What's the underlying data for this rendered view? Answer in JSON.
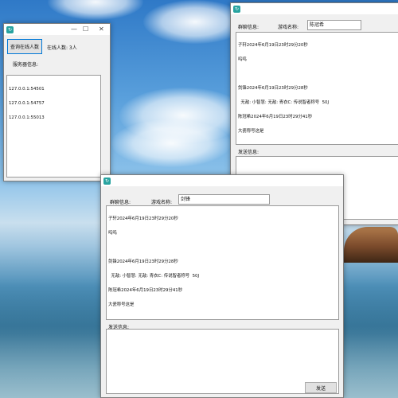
{
  "server_window": {
    "icon": "app-icon",
    "controls": [
      "—",
      "☐",
      "✕"
    ],
    "query_button": "查询在线人数",
    "online_count": "在线人数: 3人",
    "server_info_label": "服务器信息:",
    "server_lines": [
      "127.0.0.1:54501",
      "127.0.0.1:54757",
      "127.0.0.1:55013"
    ]
  },
  "client_back": {
    "icon": "app-icon",
    "group_info_label": "群聊信息:",
    "game_name_label": "游戏名称:",
    "game_name_value": "陈冠希",
    "chat_lines": [
      "子轩2024年6月19日23时29分20秒",
      "呜呜",
      "",
      "剑锋2024年6月19日23时29分28秒",
      "  无敌: 小智慧: 无敌: 青衣C: 传说智者称号  50J",
      "陈冠希2024年6月19日23时29分41秒",
      "大瓷称号这是"
    ],
    "send_label": "发送信息:"
  },
  "client_front": {
    "icon": "app-icon",
    "group_info_label": "群聊信息:",
    "game_name_label": "游戏名称:",
    "game_name_value": "剑锋",
    "chat_lines": [
      "子轩2024年6月19日23时29分20秒",
      "呜呜",
      "",
      "剑锋2024年6月19日23时29分28秒",
      "  无敌: 小智慧: 无敌: 青衣C: 传说智者称号  50J",
      "陈冠希2024年6月19日23时29分41秒",
      "大瓷称号这是"
    ],
    "send_label": "发送信息:",
    "send_button": "发送"
  }
}
